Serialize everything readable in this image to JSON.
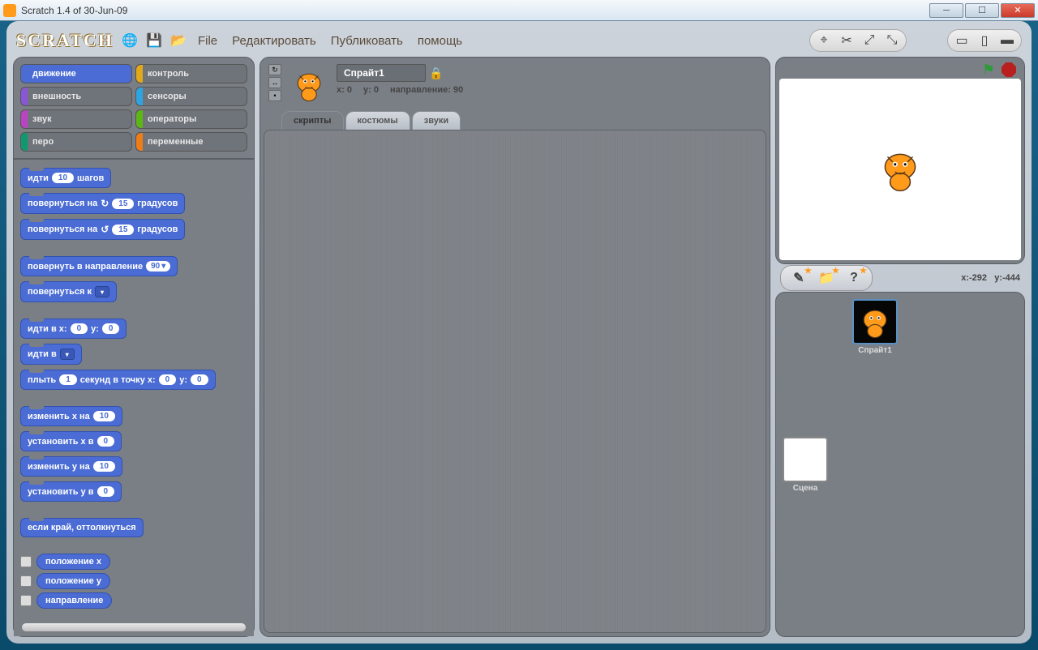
{
  "window": {
    "title": "Scratch 1.4 of 30-Jun-09"
  },
  "logo": "SCRATCH",
  "menu": {
    "file": "File",
    "edit": "Редактировать",
    "share": "Публиковать",
    "help": "помощь"
  },
  "categories": [
    {
      "label": "движение",
      "color": "#4a6cd4",
      "active": true
    },
    {
      "label": "контроль",
      "color": "#e1a91a"
    },
    {
      "label": "внешность",
      "color": "#8a55d7"
    },
    {
      "label": "сенсоры",
      "color": "#2ca5e2"
    },
    {
      "label": "звук",
      "color": "#bb42c3"
    },
    {
      "label": "операторы",
      "color": "#5cb712"
    },
    {
      "label": "перо",
      "color": "#0e9a6c"
    },
    {
      "label": "переменные",
      "color": "#ee7d16"
    }
  ],
  "blocks": {
    "move": {
      "pre": "идти",
      "val": "10",
      "post": "шагов"
    },
    "turn_cw": {
      "pre": "повернуться на",
      "icon": "↻",
      "val": "15",
      "post": "градусов"
    },
    "turn_ccw": {
      "pre": "повернуться на",
      "icon": "↺",
      "val": "15",
      "post": "градусов"
    },
    "point_dir": {
      "pre": "повернуть в направление",
      "val": "90"
    },
    "point_to": {
      "pre": "повернуться к"
    },
    "goto_xy": {
      "pre": "идти в x:",
      "x": "0",
      "mid": "y:",
      "y": "0"
    },
    "goto": {
      "pre": "идти в"
    },
    "glide": {
      "pre": "плыть",
      "sec": "1",
      "mid1": "секунд в точку x:",
      "x": "0",
      "mid2": "y:",
      "y": "0"
    },
    "change_x": {
      "pre": "изменить x на",
      "val": "10"
    },
    "set_x": {
      "pre": "установить x в",
      "val": "0"
    },
    "change_y": {
      "pre": "изменить y на",
      "val": "10"
    },
    "set_y": {
      "pre": "установить y в",
      "val": "0"
    },
    "bounce": {
      "pre": "если край, оттолкнуться"
    }
  },
  "reporters": {
    "xpos": "положение x",
    "ypos": "положение y",
    "dir": "направление"
  },
  "sprite": {
    "name": "Спрайт1",
    "x_label": "x:",
    "x_val": "0",
    "y_label": "y:",
    "y_val": "0",
    "dir_label": "направление:",
    "dir_val": "90"
  },
  "tabs": {
    "scripts": "скрипты",
    "costumes": "костюмы",
    "sounds": "звуки"
  },
  "stage": {
    "mouse_x_label": "x:",
    "mouse_x": "-292",
    "mouse_y_label": "y:",
    "mouse_y": "-444",
    "stage_label": "Сцена",
    "sprite1": "Спрайт1"
  }
}
